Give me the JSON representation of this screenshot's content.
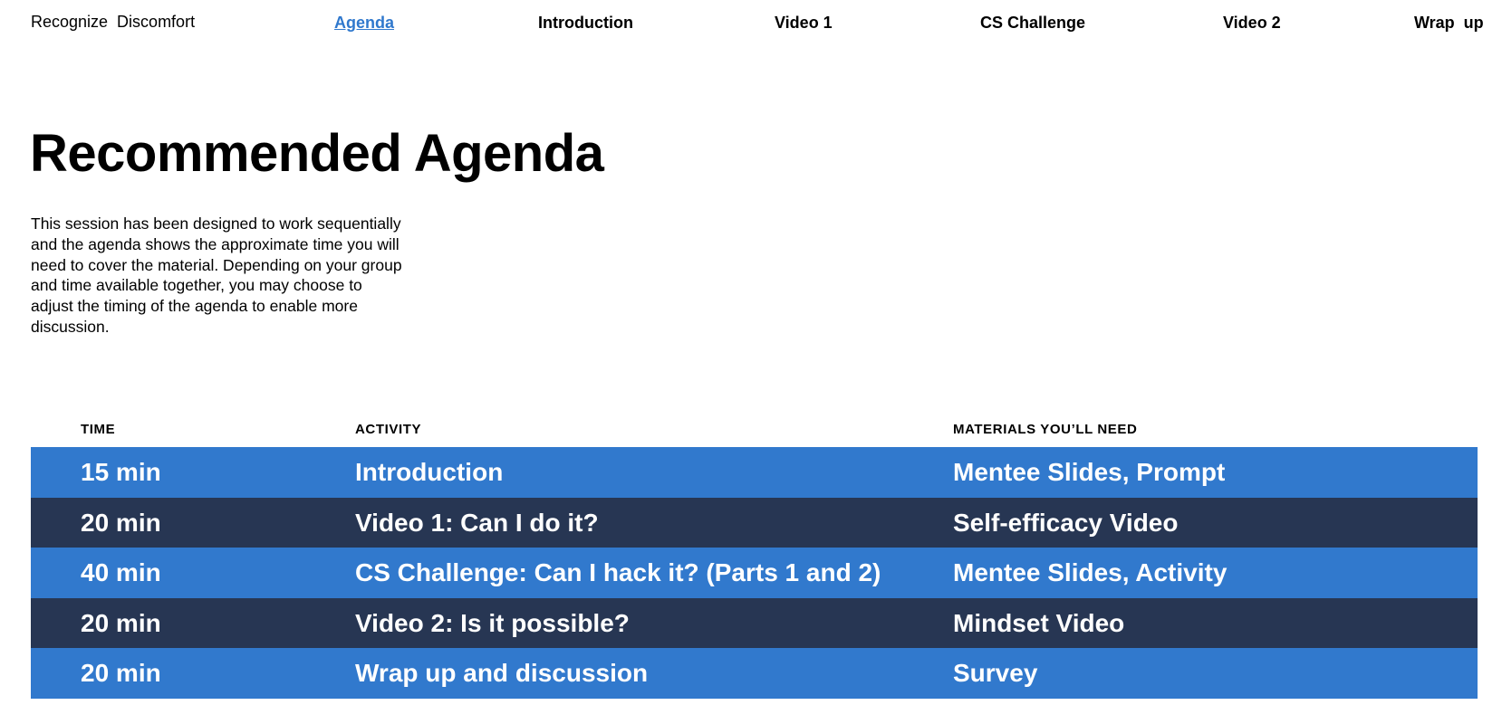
{
  "brand": "Recognize  Discomfort",
  "nav": {
    "agenda": "Agenda",
    "introduction": "Introduction",
    "video1": "Video 1",
    "cs_challenge": "CS Challenge",
    "video2": "Video 2",
    "wrap_up": "Wrap  up"
  },
  "colors": {
    "accent_link": "#2f78cd",
    "row_light": "#3179cd",
    "row_dark": "#273653"
  },
  "page_title": "Recommended Agenda",
  "intro_text": "This session has been designed to work sequentially and the agenda shows the approximate time you will need to cover the material. Depending on your  group and time available together, you may choose to adjust the timing of the agenda to enable more discussion.",
  "table": {
    "headers": {
      "time": "TIME",
      "activity": "ACTIVITY",
      "materials": "MATERIALS YOU’LL NEED"
    },
    "rows": [
      {
        "time": "15 min",
        "activity": "Introduction",
        "materials": "Mentee Slides, Prompt",
        "shade": "light"
      },
      {
        "time": "20 min",
        "activity": "Video 1: Can I do it?",
        "materials": "Self-efficacy Video",
        "shade": "dark"
      },
      {
        "time": "40 min",
        "activity": "CS Challenge: Can I hack it? (Parts 1 and 2)",
        "materials": "Mentee Slides, Activity",
        "shade": "light"
      },
      {
        "time": "20 min",
        "activity": "Video 2: Is it possible?",
        "materials": "Mindset Video",
        "shade": "dark"
      },
      {
        "time": "20 min",
        "activity": "Wrap up and discussion",
        "materials": "Survey",
        "shade": "light"
      }
    ]
  }
}
